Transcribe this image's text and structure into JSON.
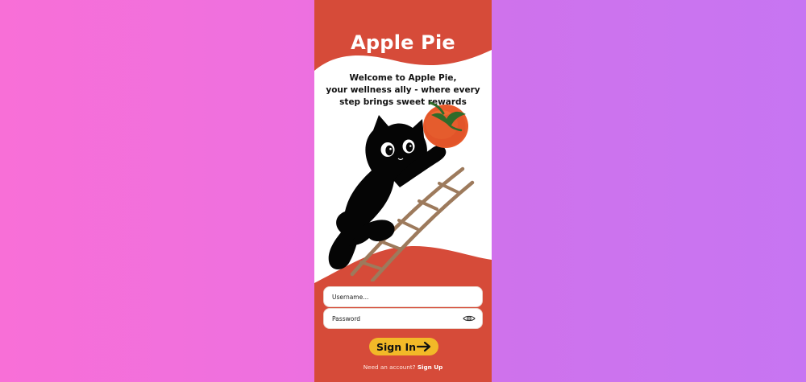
{
  "app": {
    "title": "Apple Pie"
  },
  "welcome": {
    "lines": [
      "Welcome to Apple Pie,",
      "your wellness ally - where every",
      "step brings sweet rewards"
    ]
  },
  "form": {
    "username_placeholder": "Username...",
    "password_placeholder": "Password",
    "signin_label": "Sign In"
  },
  "footer": {
    "prompt": "Need an account?",
    "signup_label": "Sign Up"
  },
  "icons": {
    "password_toggle": "eye-icon",
    "signin_arrow": "arrow-right-icon"
  },
  "colors": {
    "background_left": "#f86fd7",
    "background_right": "#c775f2",
    "brand_red": "#d64b39",
    "button_yellow": "#f2b928",
    "white": "#ffffff"
  }
}
